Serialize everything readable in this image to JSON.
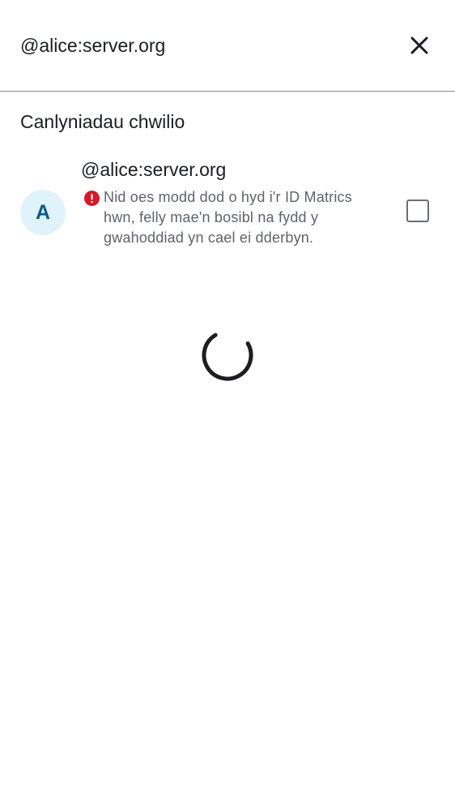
{
  "search": {
    "query": "@alice:server.org",
    "close_icon": "close-icon"
  },
  "results": {
    "section_title": "Canlyniadau chwilio",
    "items": [
      {
        "avatar_letter": "A",
        "user_id": "@alice:server.org",
        "warning_icon": "error-icon",
        "warning_text": "Nid oes modd dod o hyd i'r ID Matrics hwn, felly mae'n bosibl na fydd y gwahoddiad yn cael ei dderbyn.",
        "checked": false
      }
    ]
  },
  "loading": {
    "spinner_icon": "spinner-icon"
  },
  "colors": {
    "avatar_bg": "#e1f3fa",
    "avatar_fg": "#0c5c89",
    "error": "#d51928",
    "text_primary": "#1b1d22",
    "text_secondary": "#5f636a",
    "divider": "#8b8d95"
  }
}
